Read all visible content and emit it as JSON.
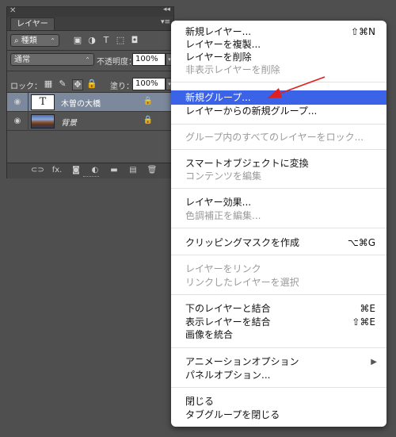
{
  "panel": {
    "close_glyph": "✕",
    "collapse_glyph": "◂◂",
    "tab_label": "レイヤー",
    "panel_menu_glyph": "▾≡",
    "filter_label": "⌕ 種類",
    "filter_arrow": "⌃",
    "filter_icons": [
      "▣",
      "◑",
      "T",
      "⬚",
      "◘"
    ],
    "blend_mode": "通常",
    "blend_arrow": "⌃",
    "opacity_label": "不透明度：",
    "opacity_value": "100%",
    "lock_label": "ロック：",
    "lock_icons": [
      "▦",
      "✎",
      "✥",
      "🔒"
    ],
    "fill_label": "塗り：",
    "fill_value": "100%",
    "stepper_glyph": "▾",
    "layers": [
      {
        "name": "木曽の大橋",
        "thumb": "T",
        "selected": true
      },
      {
        "name": "背景",
        "thumb": "image",
        "selected": false
      }
    ],
    "eye_glyph": "◉",
    "lock_glyph": "🔒",
    "bottom_icons": [
      "⊂⊃",
      "fx.",
      "◙",
      "◐",
      "▬",
      "▤",
      "🗑"
    ]
  },
  "menu": {
    "items": [
      {
        "label": "新規レイヤー...",
        "shortcut": "⇧⌘N",
        "disabled": false
      },
      {
        "label": "レイヤーを複製...",
        "shortcut": "",
        "disabled": false
      },
      {
        "label": "レイヤーを削除",
        "shortcut": "",
        "disabled": false
      },
      {
        "label": "非表示レイヤーを削除",
        "shortcut": "",
        "disabled": true
      },
      {
        "label": "新規グループ...",
        "shortcut": "",
        "disabled": false,
        "highlighted": true
      },
      {
        "label": "レイヤーからの新規グループ...",
        "shortcut": "",
        "disabled": false
      },
      {
        "label": "グループ内のすべてのレイヤーをロック...",
        "shortcut": "",
        "disabled": true
      },
      {
        "label": "スマートオブジェクトに変換",
        "shortcut": "",
        "disabled": false
      },
      {
        "label": "コンテンツを編集",
        "shortcut": "",
        "disabled": true
      },
      {
        "label": "レイヤー効果...",
        "shortcut": "",
        "disabled": false
      },
      {
        "label": "色調補正を編集...",
        "shortcut": "",
        "disabled": true
      },
      {
        "label": "クリッピングマスクを作成",
        "shortcut": "⌥⌘G",
        "disabled": false
      },
      {
        "label": "レイヤーをリンク",
        "shortcut": "",
        "disabled": true
      },
      {
        "label": "リンクしたレイヤーを選択",
        "shortcut": "",
        "disabled": true
      },
      {
        "label": "下のレイヤーと結合",
        "shortcut": "⌘E",
        "disabled": false
      },
      {
        "label": "表示レイヤーを結合",
        "shortcut": "⇧⌘E",
        "disabled": false
      },
      {
        "label": "画像を統合",
        "shortcut": "",
        "disabled": false
      },
      {
        "label": "アニメーションオプション",
        "shortcut": "",
        "disabled": false,
        "submenu": true
      },
      {
        "label": "パネルオプション...",
        "shortcut": "",
        "disabled": false
      },
      {
        "label": "閉じる",
        "shortcut": "",
        "disabled": false
      },
      {
        "label": "タブグループを閉じる",
        "shortcut": "",
        "disabled": false
      }
    ],
    "submenu_glyph": "▶"
  },
  "colors": {
    "highlight": "#3a63e8",
    "annotation_arrow": "#e02020",
    "selected_layer": "#7c889c"
  }
}
